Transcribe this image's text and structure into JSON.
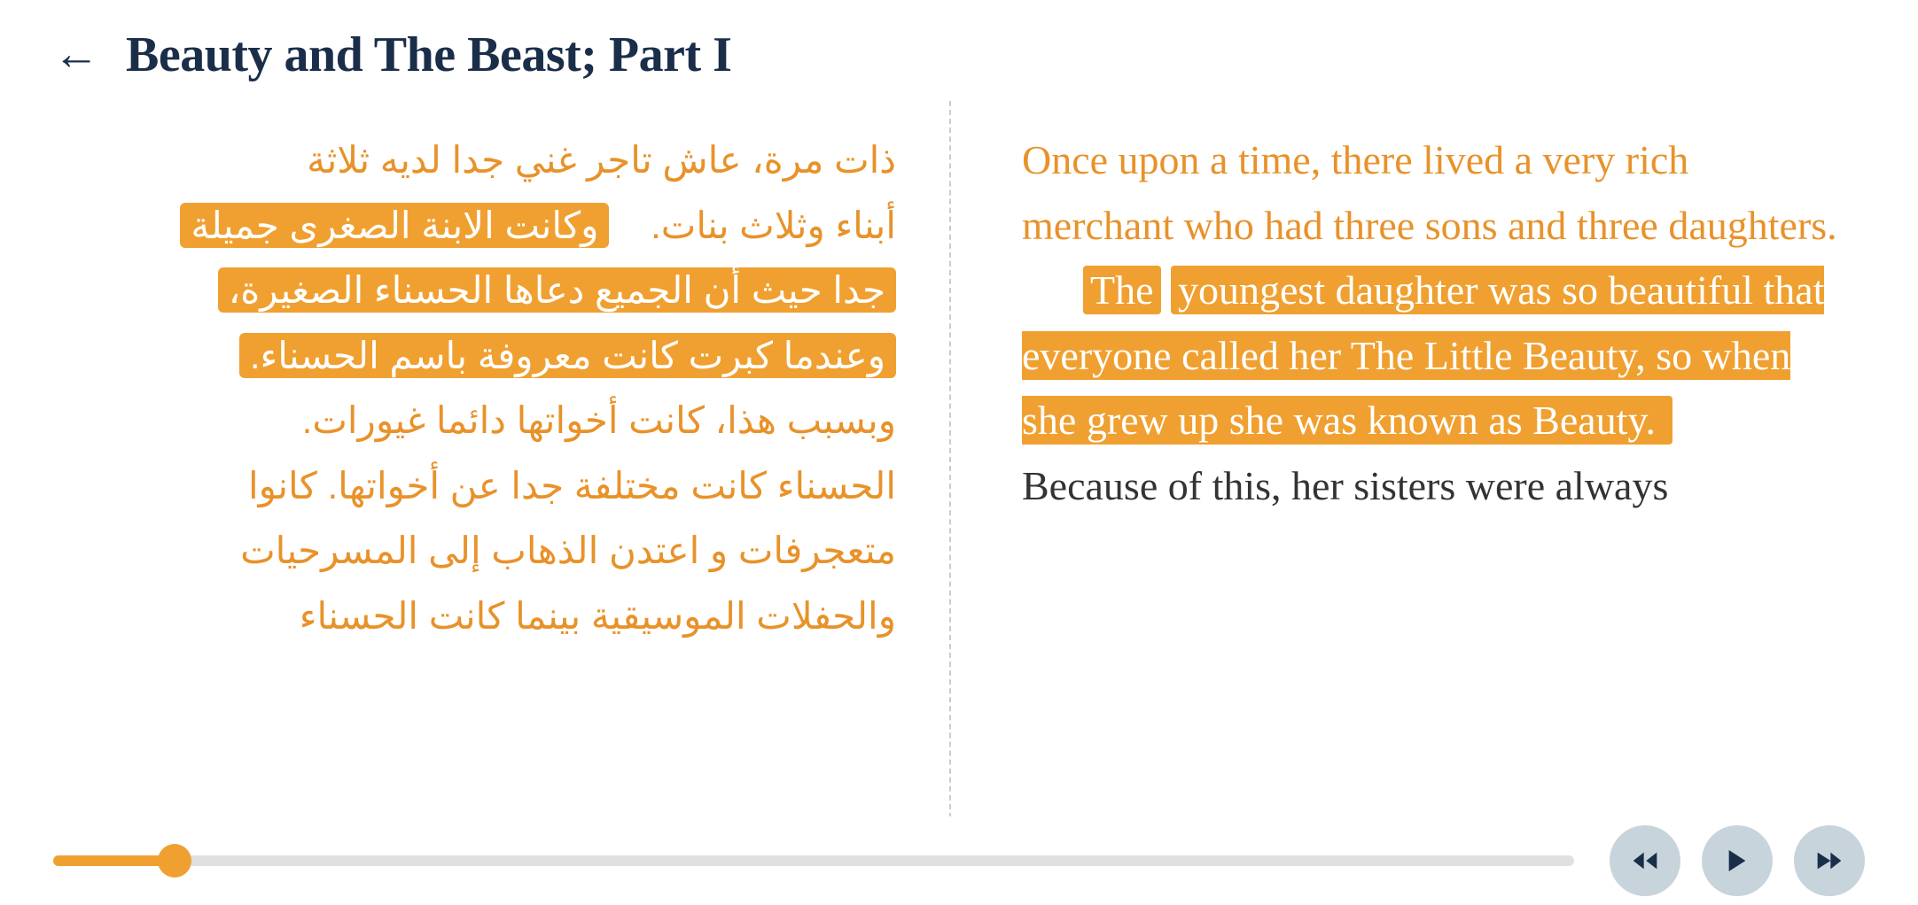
{
  "header": {
    "back_label": "←",
    "title": "Beauty and The Beast; Part I"
  },
  "arabic": {
    "paragraph1_normal": "ذات مرة، عاش تاجر غني جدا لديه ثلاثة",
    "paragraph1_normal2": "أبناء وثلاث بنات.",
    "paragraph1_highlighted": "وكانت الابنة الصغرى جميلة",
    "paragraph2_highlighted1": "جدا حيث أن الجميع دعاها الحسناء الصغيرة،",
    "paragraph2_highlighted2": "وعندما كبرت كانت معروفة باسم الحسناء.",
    "paragraph3": "وبسبب هذا، كانت أخواتها دائما غيورات.",
    "paragraph4": "الحسناء كانت مختلفة جدا عن أخواتها.  كانوا",
    "paragraph5": "متعجرفات و اعتدن الذهاب إلى المسرحيات",
    "paragraph6": "والحفلات الموسيقية بينما كانت الحسناء"
  },
  "english": {
    "paragraph1_normal": "Once upon a time, there lived a very rich merchant who had three sons and three daughters.",
    "paragraph1_highlighted_prefix": "The",
    "paragraph2_highlighted": "youngest daughter was so beautiful that everyone called her The Little Beauty, so when she grew up she was known as Beauty.",
    "paragraph3_normal": "Because of this, her sisters were always"
  },
  "progress": {
    "fill_percent": 8
  },
  "controls": {
    "rewind_label": "⏮",
    "play_label": "▶",
    "forward_label": "⏭"
  }
}
